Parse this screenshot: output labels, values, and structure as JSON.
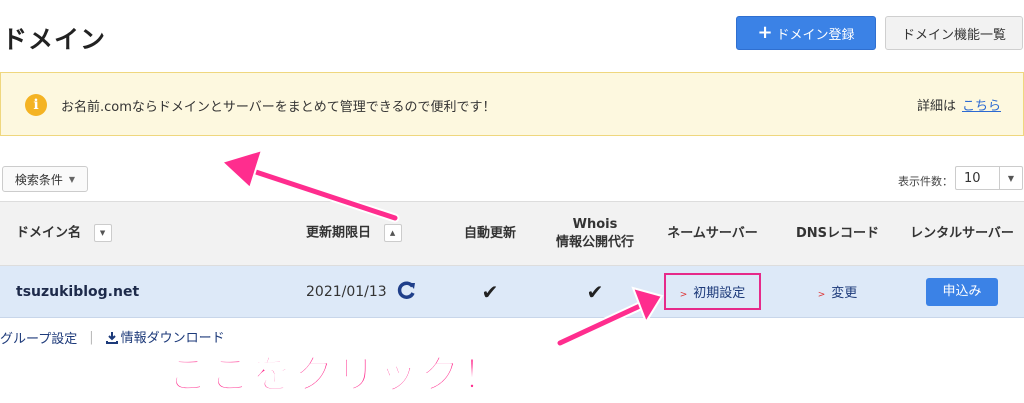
{
  "page": {
    "title": "ドメイン"
  },
  "header": {
    "register_label": "ドメイン登録",
    "features_label": "ドメイン機能一覧"
  },
  "notice": {
    "message": "お名前.comならドメインとサーバーをまとめて管理できるので便利です！",
    "detail_prefix": "詳細は",
    "detail_link": "こちら"
  },
  "toolbar": {
    "search_label": "検索条件",
    "count_label": "表示件数：",
    "count_value": "10"
  },
  "table": {
    "headers": {
      "domain": "ドメイン名",
      "expiry": "更新期限日",
      "auto_renew": "自動更新",
      "whois_line1": "Whois",
      "whois_line2": "情報公開代行",
      "nameserver": "ネームサーバー",
      "dns": "DNSレコード",
      "rental": "レンタルサーバー"
    },
    "rows": [
      {
        "domain": "tsuzukiblog.net",
        "expiry": "2021/01/13",
        "auto_renew": "✔",
        "whois": "✔",
        "nameserver": "初期設定",
        "dns": "変更",
        "rental": "申込み"
      }
    ]
  },
  "footer": {
    "group_settings": "グループ設定",
    "download": "情報ダウンロード"
  },
  "annotation": {
    "text": "ここをクリック！"
  },
  "colors": {
    "accent": "#3b82e6",
    "highlight": "#e62a8a",
    "annotation": "#ff2d8e"
  }
}
